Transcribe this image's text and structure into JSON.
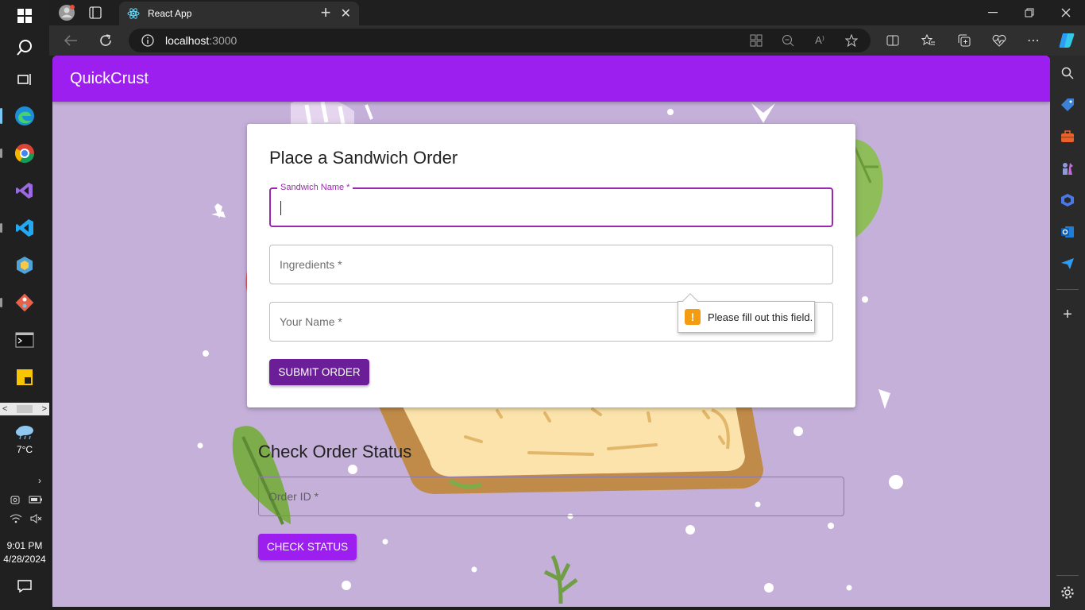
{
  "browser": {
    "tab_title": "React App",
    "url_host": "localhost",
    "url_port": ":3000"
  },
  "app": {
    "title": "QuickCrust",
    "accent_color": "#9c1ff0"
  },
  "order_form": {
    "heading": "Place a Sandwich Order",
    "sandwich_name_label": "Sandwich Name *",
    "ingredients_placeholder": "Ingredients *",
    "your_name_placeholder": "Your Name *",
    "submit_label": "SUBMIT ORDER",
    "validation_message": "Please fill out this field."
  },
  "status_form": {
    "heading": "Check Order Status",
    "order_id_placeholder": "Order ID *",
    "check_label": "CHECK STATUS"
  },
  "taskbar": {
    "weather_temp": "7°C",
    "time": "9:01 PM",
    "date": "4/28/2024"
  }
}
